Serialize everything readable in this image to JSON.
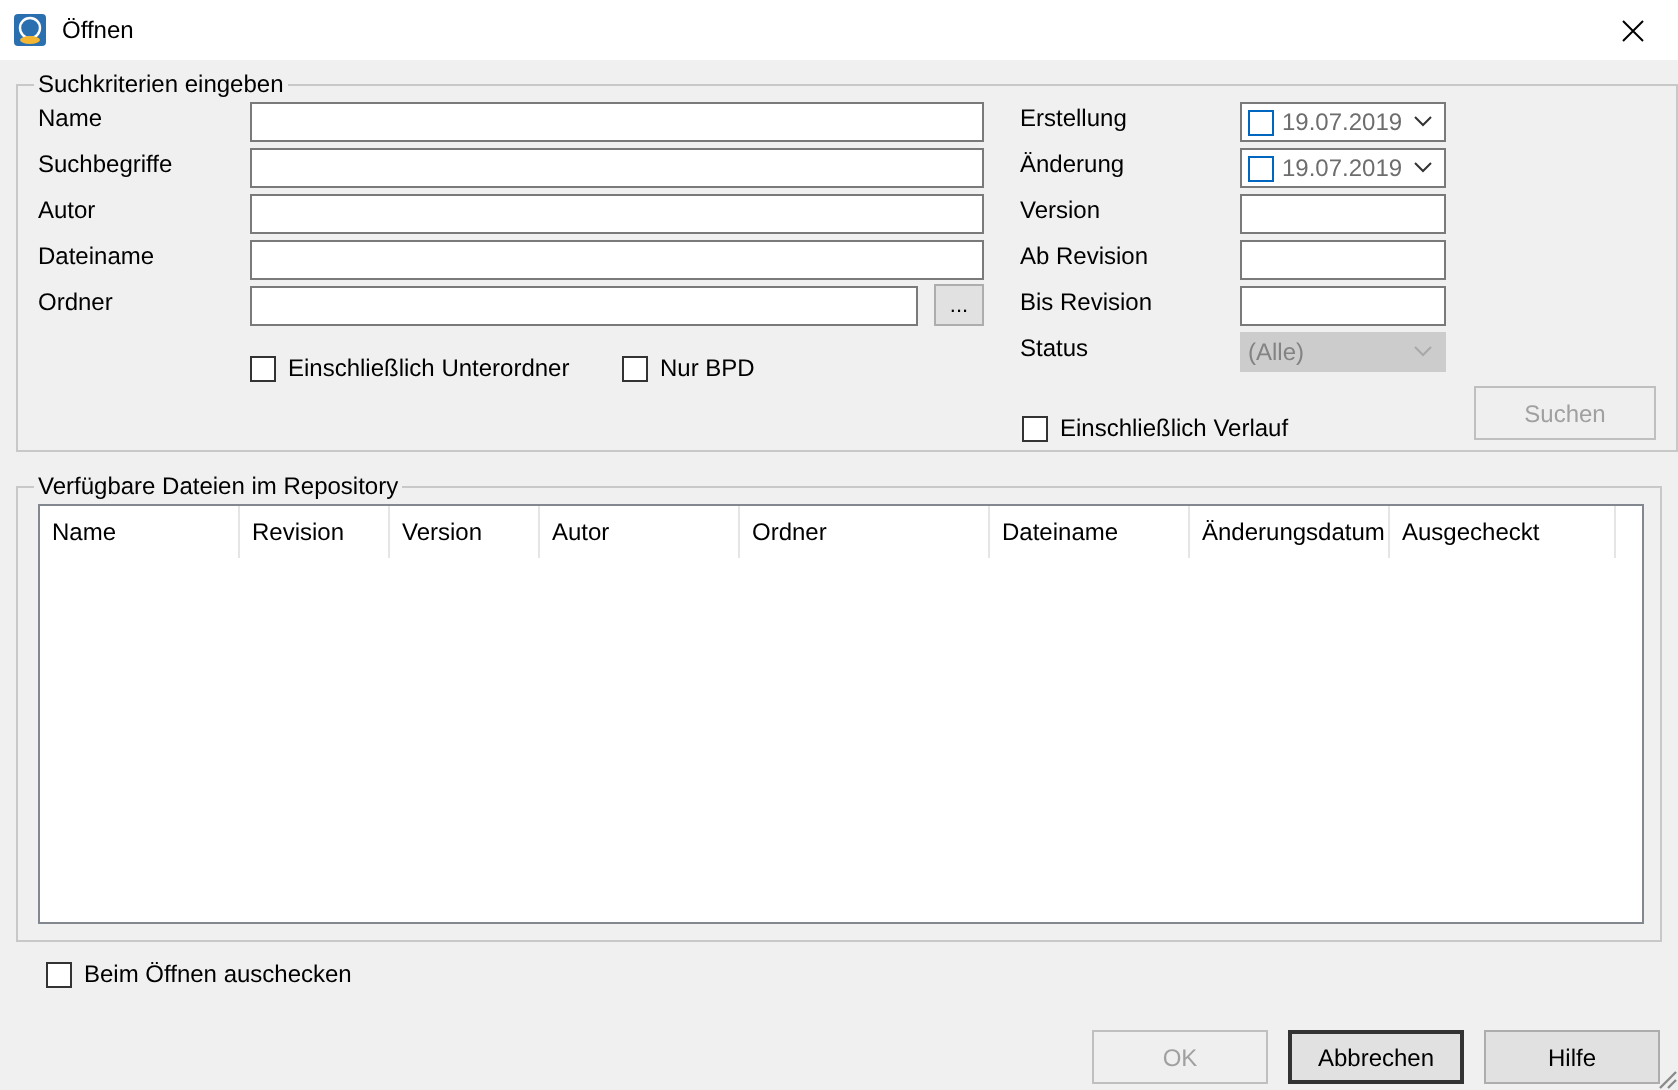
{
  "window": {
    "title": "Öffnen"
  },
  "search_group": {
    "legend": "Suchkriterien eingeben",
    "left_fields": [
      {
        "label": "Name",
        "kind": "text"
      },
      {
        "label": "Suchbegriffe",
        "kind": "text"
      },
      {
        "label": "Autor",
        "kind": "text"
      },
      {
        "label": "Dateiname",
        "kind": "text"
      },
      {
        "label": "Ordner",
        "kind": "browse",
        "button_label": "..."
      }
    ],
    "options": [
      {
        "label": "Einschließlich Unterordner",
        "checked": false
      },
      {
        "label": "Nur BPD",
        "checked": false
      }
    ],
    "right_fields": [
      {
        "label": "Erstellung",
        "kind": "date",
        "checked": false,
        "value": "19.07.2019"
      },
      {
        "label": "Änderung",
        "kind": "date",
        "checked": false,
        "value": "19.07.2019"
      },
      {
        "label": "Version",
        "kind": "text"
      },
      {
        "label": "Ab Revision",
        "kind": "text"
      },
      {
        "label": "Bis Revision",
        "kind": "text"
      },
      {
        "label": "Status",
        "kind": "combo",
        "value": "(Alle)",
        "disabled": true
      }
    ],
    "history_option": {
      "label": "Einschließlich Verlauf",
      "checked": false
    },
    "search_button": {
      "label": "Suchen",
      "disabled": true
    }
  },
  "files_group": {
    "legend": "Verfügbare Dateien im Repository",
    "table": {
      "columns": [
        "Name",
        "Revision",
        "Version",
        "Autor",
        "Ordner",
        "Dateiname",
        "Änderungsdatum",
        "Ausgecheckt"
      ]
    }
  },
  "checkout_option": {
    "label": "Beim Öffnen auschecken",
    "checked": false
  },
  "buttons": [
    {
      "label": "OK",
      "disabled": true,
      "default": false
    },
    {
      "label": "Abbrechen",
      "disabled": false,
      "default": true
    },
    {
      "label": "Hilfe",
      "disabled": false,
      "default": false
    }
  ]
}
